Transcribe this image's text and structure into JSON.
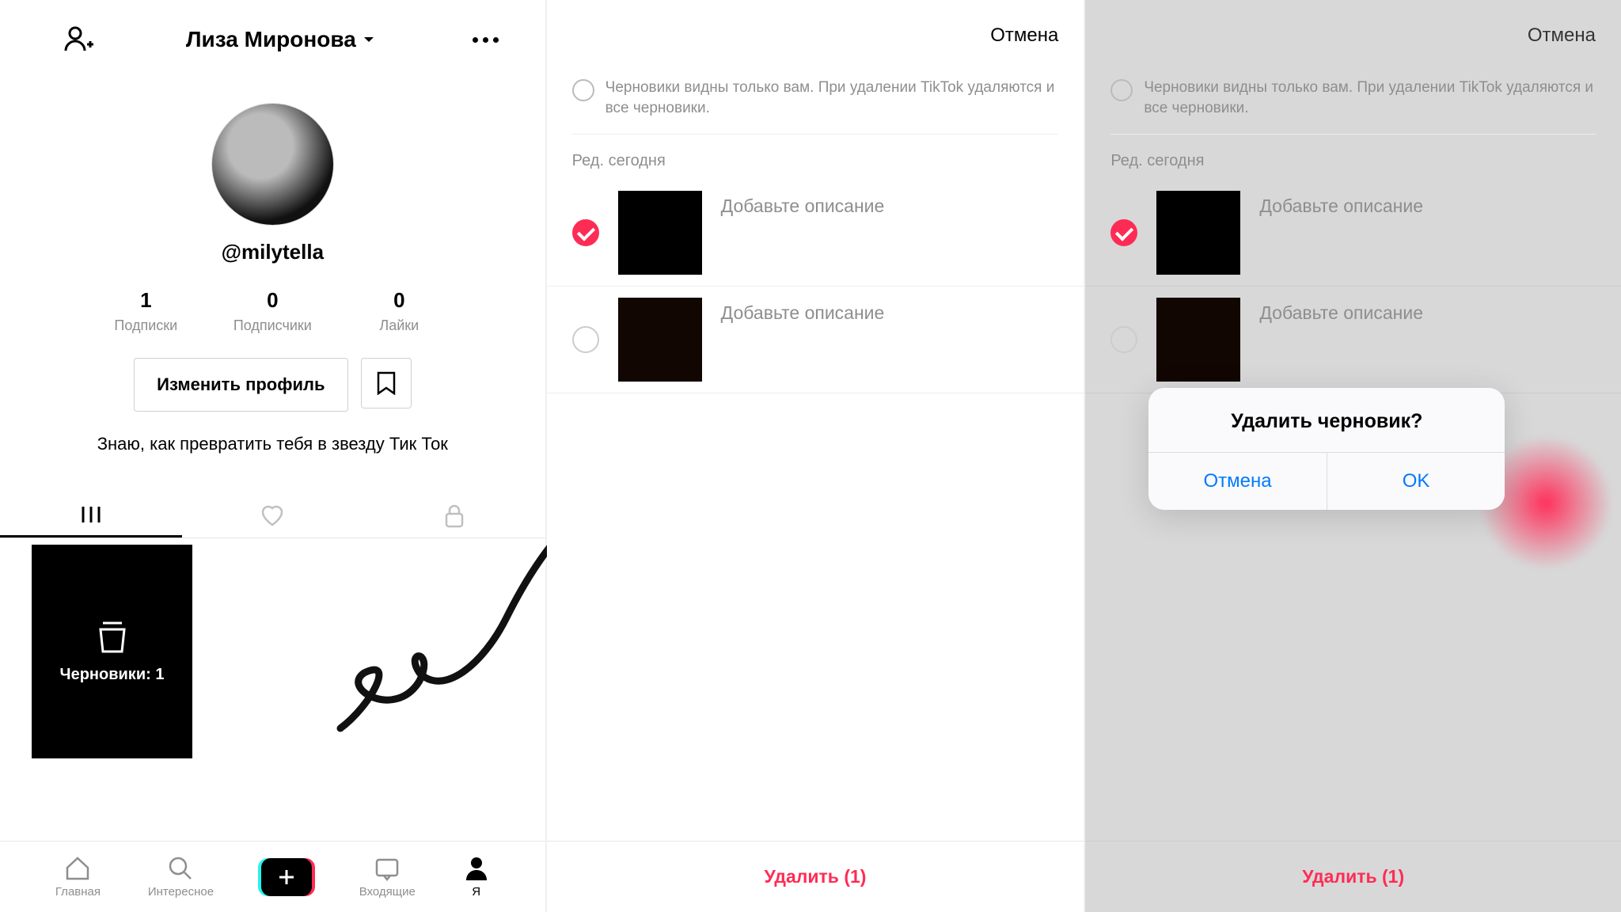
{
  "panel1": {
    "header": {
      "display_name": "Лиза Миронова"
    },
    "username": "@milytella",
    "stats": [
      {
        "value": "1",
        "label": "Подписки"
      },
      {
        "value": "0",
        "label": "Подписчики"
      },
      {
        "value": "0",
        "label": "Лайки"
      }
    ],
    "edit_button": "Изменить профиль",
    "bio": "Знаю, как превратить тебя в звезду Тик Ток",
    "drafts_tile": "Черновики: 1",
    "nav": {
      "home": "Главная",
      "discover": "Интересное",
      "inbox": "Входящие",
      "me": "Я"
    }
  },
  "panel2": {
    "cancel": "Отмена",
    "info_text": "Черновики видны только вам. При удалении TikTok удаляются и все черновики.",
    "section": "Ред. сегодня",
    "drafts": [
      {
        "selected": true,
        "desc": "Добавьте описание"
      },
      {
        "selected": false,
        "desc": "Добавьте описание"
      }
    ],
    "delete_button": "Удалить (1)"
  },
  "panel3": {
    "cancel": "Отмена",
    "info_text": "Черновики видны только вам. При удалении TikTok удаляются и все черновики.",
    "section": "Ред. сегодня",
    "drafts": [
      {
        "selected": true,
        "desc": "Добавьте описание"
      },
      {
        "selected": false,
        "desc": "Добавьте описание"
      }
    ],
    "delete_button": "Удалить (1)",
    "alert": {
      "title": "Удалить черновик?",
      "cancel": "Отмена",
      "ok": "OK"
    }
  }
}
